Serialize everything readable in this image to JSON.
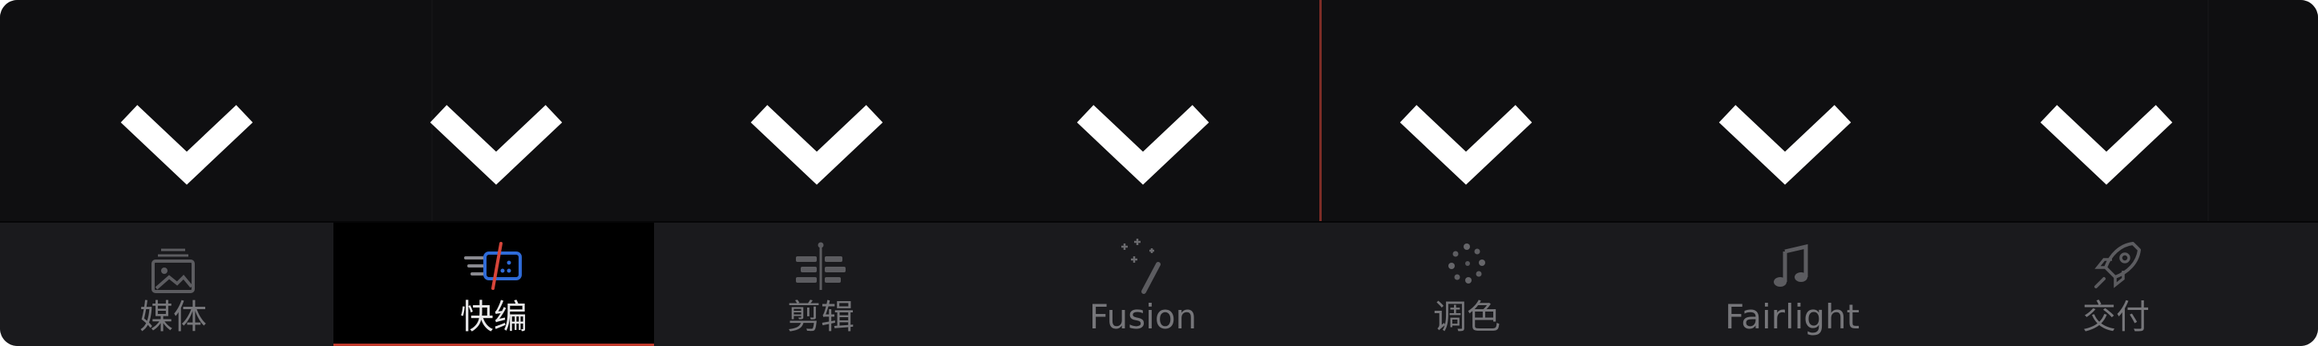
{
  "window": {
    "name": "DaVinci Resolve page bar"
  },
  "colors": {
    "background": "#0f0f11",
    "page_bar": "#1a1a1d",
    "active_page": "#000000",
    "playhead": "#7d2c26",
    "accent": "#c0392b",
    "label_inactive": "#76767a",
    "label_active": "#e8e8ea"
  },
  "expanders": [
    {
      "icon": "chevron-down-icon"
    },
    {
      "icon": "chevron-down-icon"
    },
    {
      "icon": "chevron-down-icon"
    },
    {
      "icon": "chevron-down-icon"
    },
    {
      "icon": "chevron-down-icon"
    },
    {
      "icon": "chevron-down-icon"
    },
    {
      "icon": "chevron-down-icon"
    }
  ],
  "pages": {
    "active": "快编",
    "items": [
      {
        "label": "媒体",
        "icon": "media-image-icon"
      },
      {
        "label": "快编",
        "icon": "cut-icon"
      },
      {
        "label": "剪辑",
        "icon": "edit-timeline-icon"
      },
      {
        "label": "Fusion",
        "icon": "fusion-wand-icon"
      },
      {
        "label": "调色",
        "icon": "color-dots-icon"
      },
      {
        "label": "Fairlight",
        "icon": "music-note-icon"
      },
      {
        "label": "交付",
        "icon": "rocket-icon"
      }
    ]
  }
}
